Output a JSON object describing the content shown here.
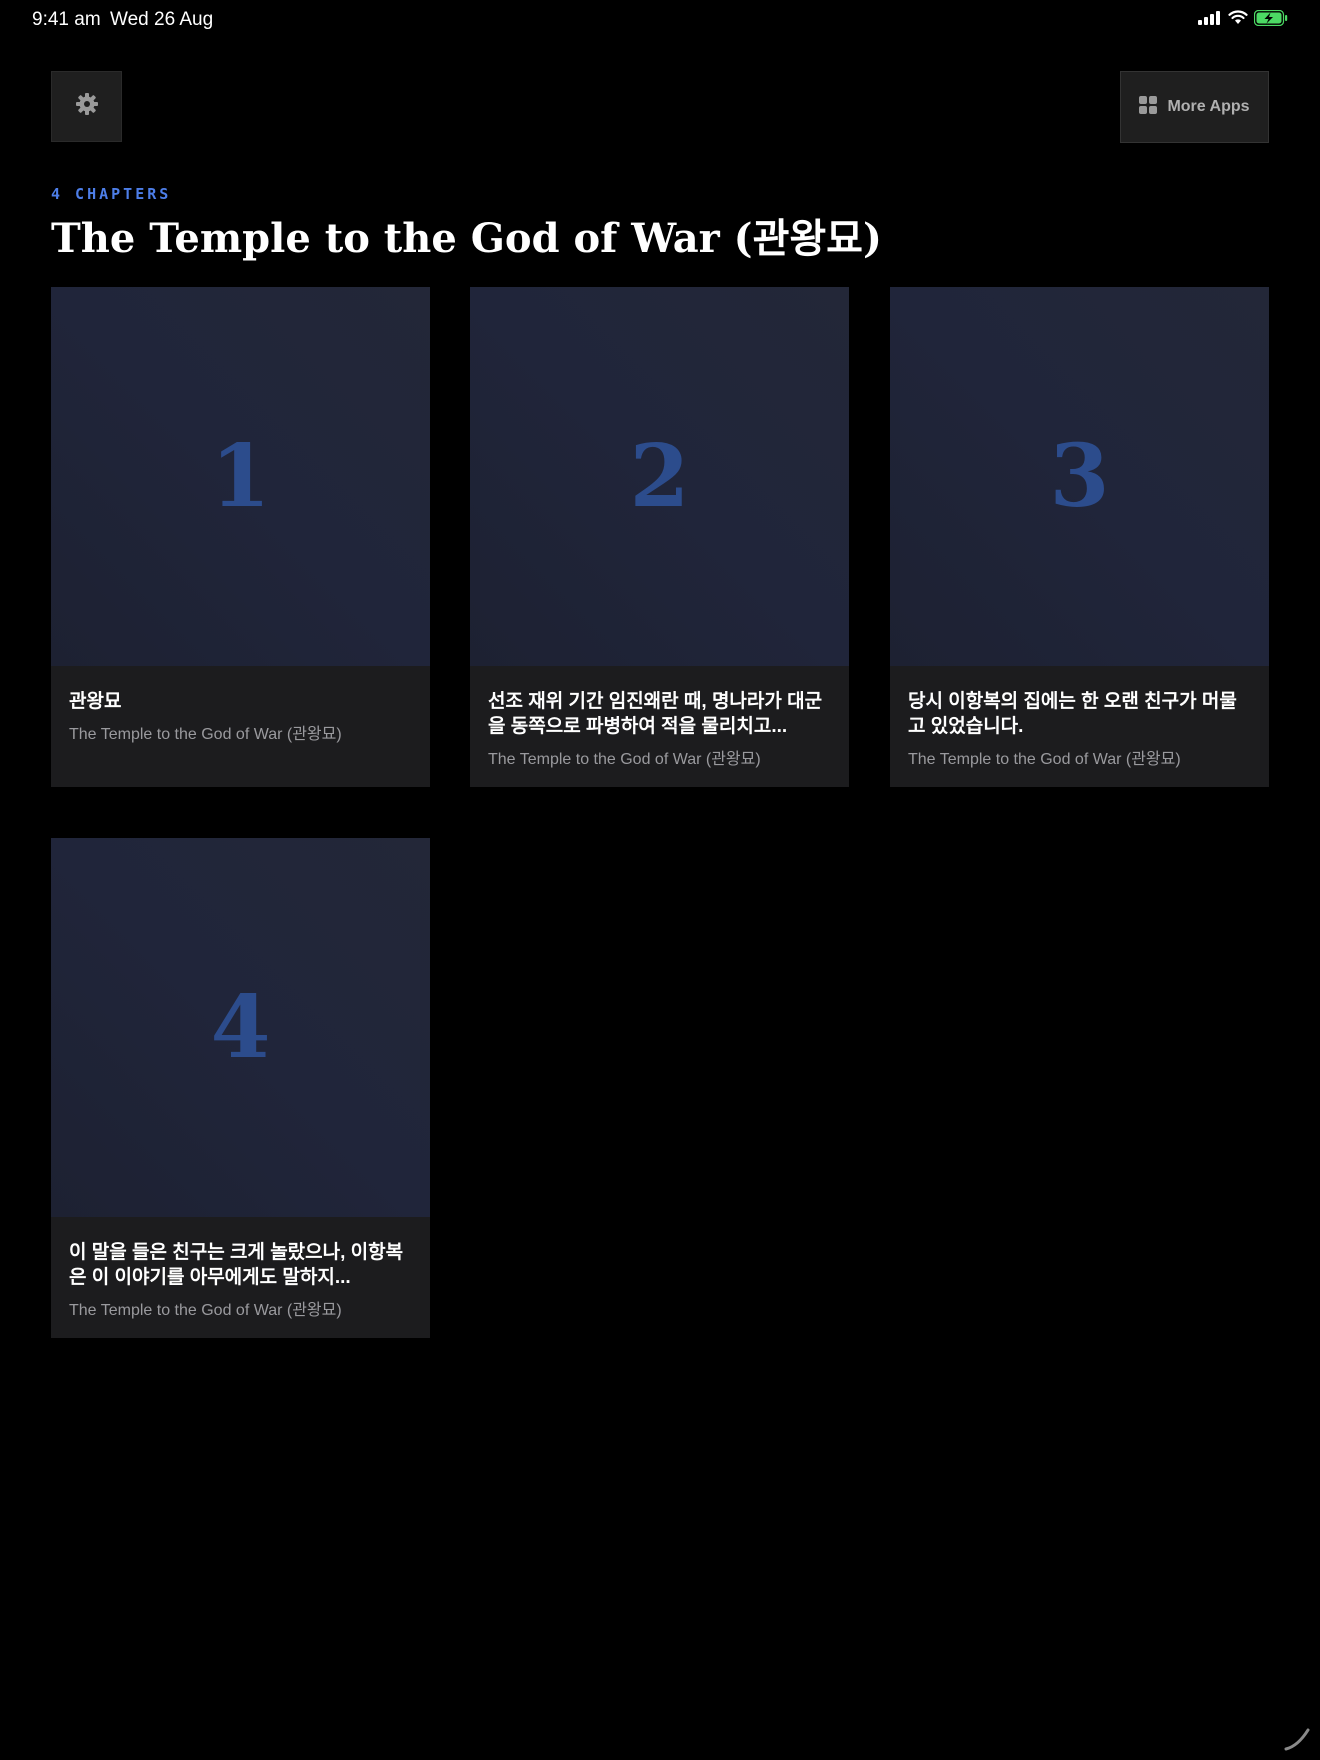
{
  "status_bar": {
    "time": "9:41 am",
    "date": "Wed 26 Aug",
    "icons": [
      "cellular-signal-icon",
      "wifi-icon",
      "battery-charging-icon"
    ]
  },
  "toolbar": {
    "settings_icon": "gear-icon",
    "more_apps_label": "More Apps",
    "more_apps_icon": "grid-icon"
  },
  "header": {
    "chapters_count": "4 CHAPTERS",
    "title": "The Temple to the God of War (관왕묘)"
  },
  "chapters": [
    {
      "number": "1",
      "title": "관왕묘",
      "subtitle": "The Temple to the God of War (관왕묘)"
    },
    {
      "number": "2",
      "title": "선조 재위 기간 임진왜란 때, 명나라가 대군을 동쪽으로 파병하여 적을 물리치고...",
      "subtitle": "The Temple to the God of War (관왕묘)"
    },
    {
      "number": "3",
      "title": "당시 이항복의 집에는 한 오랜 친구가 머물고 있었습니다.",
      "subtitle": "The Temple to the God of War (관왕묘)"
    },
    {
      "number": "4",
      "title": "이 말을 들은 친구는 크게 놀랐으나, 이항복은 이 이야기를 아무에게도 말하지...",
      "subtitle": "The Temple to the God of War (관왕묘)"
    }
  ],
  "colors": {
    "background": "#000000",
    "card": "#1c1c1e",
    "thumbnail": "#20253a",
    "accent": "#4d7ee8",
    "chapter_number": "#2c4c8c",
    "battery": "#4cd964"
  }
}
